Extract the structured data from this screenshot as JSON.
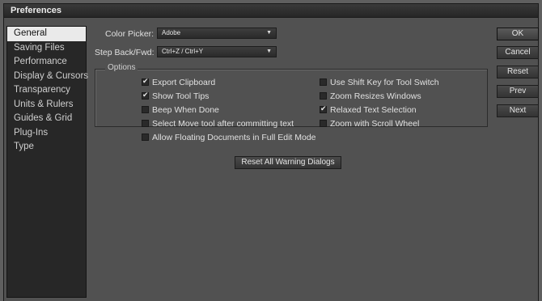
{
  "window": {
    "title": "Preferences"
  },
  "sidebar": {
    "items": [
      {
        "label": "General",
        "selected": true
      },
      {
        "label": "Saving Files"
      },
      {
        "label": "Performance"
      },
      {
        "label": "Display & Cursors"
      },
      {
        "label": "Transparency"
      },
      {
        "label": "Units & Rulers"
      },
      {
        "label": "Guides & Grid"
      },
      {
        "label": "Plug-Ins"
      },
      {
        "label": "Type"
      }
    ]
  },
  "fields": {
    "color_picker_label": "Color Picker:",
    "color_picker_value": "Adobe",
    "step_label": "Step Back/Fwd:",
    "step_value": "Ctrl+Z / Ctrl+Y"
  },
  "options": {
    "legend": "Options",
    "checkboxes": [
      {
        "label": "Export Clipboard",
        "checked": true
      },
      {
        "label": "Show Tool Tips",
        "checked": true
      },
      {
        "label": "Beep When Done",
        "checked": false
      },
      {
        "label": "Select Move tool after committing text",
        "checked": false
      },
      {
        "label": "Allow Floating Documents in Full Edit Mode",
        "checked": false
      },
      {
        "label": "Use Shift Key for Tool Switch",
        "checked": false
      },
      {
        "label": "Zoom Resizes Windows",
        "checked": false
      },
      {
        "label": "Relaxed Text Selection",
        "checked": true
      },
      {
        "label": "Zoom with Scroll Wheel",
        "checked": false
      }
    ]
  },
  "reset_warnings_label": "Reset All Warning Dialogs",
  "buttons": {
    "ok": "OK",
    "cancel": "Cancel",
    "reset": "Reset",
    "prev": "Prev",
    "next": "Next"
  },
  "icons": {
    "dropdown": "chevron-down-icon",
    "check": "checkmark-icon"
  }
}
